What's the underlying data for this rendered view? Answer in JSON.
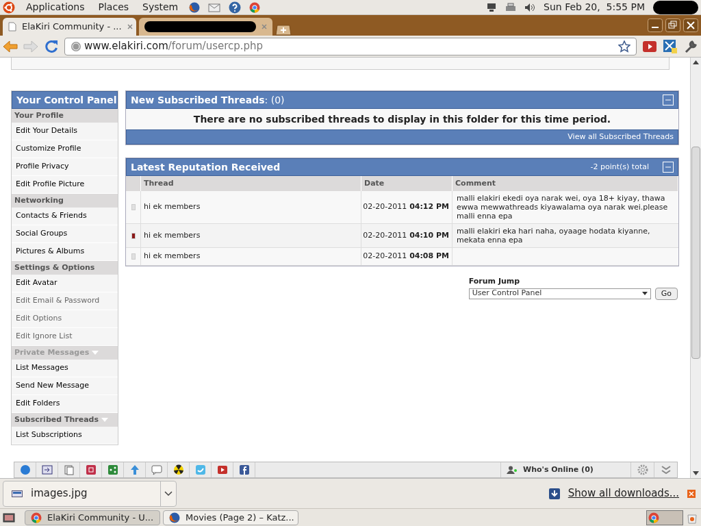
{
  "top_panel": {
    "menus": [
      "Applications",
      "Places",
      "System"
    ],
    "clock": "Sun Feb 20,  5:55 PM"
  },
  "tabs": [
    {
      "kind": "page",
      "label": "ElaKiri Community - ...",
      "selected": true
    },
    {
      "kind": "redacted",
      "selected": false
    }
  ],
  "address_bar": {
    "host": "www.elakiri.com",
    "path": "/forum/usercp.php"
  },
  "sidebar": {
    "title": "Your Control Panel",
    "items": [
      {
        "kind": "header",
        "label": "Your Profile",
        "dimmed": false,
        "collapsible": false
      },
      {
        "kind": "link",
        "label": "Edit Your Details",
        "dimmed": false
      },
      {
        "kind": "link",
        "label": "Customize Profile",
        "dimmed": false
      },
      {
        "kind": "link",
        "label": "Profile Privacy",
        "dimmed": false
      },
      {
        "kind": "link",
        "label": "Edit Profile Picture",
        "dimmed": false
      },
      {
        "kind": "header",
        "label": "Networking",
        "dimmed": false,
        "collapsible": false
      },
      {
        "kind": "link",
        "label": "Contacts & Friends",
        "dimmed": false
      },
      {
        "kind": "link",
        "label": "Social Groups",
        "dimmed": false
      },
      {
        "kind": "link",
        "label": "Pictures & Albums",
        "dimmed": false
      },
      {
        "kind": "header",
        "label": "Settings & Options",
        "dimmed": false,
        "collapsible": false
      },
      {
        "kind": "link",
        "label": "Edit Avatar",
        "dimmed": false
      },
      {
        "kind": "link",
        "label": "Edit Email & Password",
        "dimmed": true
      },
      {
        "kind": "link",
        "label": "Edit Options",
        "dimmed": true
      },
      {
        "kind": "link",
        "label": "Edit Ignore List",
        "dimmed": true
      },
      {
        "kind": "header",
        "label": "Private Messages",
        "dimmed": true,
        "collapsible": true
      },
      {
        "kind": "link",
        "label": "List Messages",
        "dimmed": false
      },
      {
        "kind": "link",
        "label": "Send New Message",
        "dimmed": false
      },
      {
        "kind": "link",
        "label": "Edit Folders",
        "dimmed": false
      },
      {
        "kind": "header",
        "label": "Subscribed Threads",
        "dimmed": false,
        "collapsible": true
      },
      {
        "kind": "link",
        "label": "List Subscriptions",
        "dimmed": false
      }
    ]
  },
  "subscribed": {
    "title": "New Subscribed Threads",
    "count": ": (0)",
    "message": "There are no subscribed threads to display in this folder for this time period.",
    "footer_link": "View all Subscribed Threads"
  },
  "reputation": {
    "title": "Latest Reputation Received",
    "total": "-2 point(s) total",
    "columns": [
      "Thread",
      "Date",
      "Comment"
    ],
    "rows": [
      {
        "color": "#e0e0e0",
        "thread": "hi ek members",
        "date": "02-20-2011",
        "time": "04:12 PM",
        "comment": "malli elakiri ekedi oya narak wei, oya 18+ kiyay, thawa ewwa mewwathreads kiyawalama oya narak wei.please malli enna epa"
      },
      {
        "color": "#8b1a1a",
        "thread": "hi ek members",
        "date": "02-20-2011",
        "time": "04:10 PM",
        "comment": "malli elakiri eka hari naha, oyaage hodata kiyanne, mekata enna epa"
      },
      {
        "color": "#e0e0e0",
        "thread": "hi ek members",
        "date": "02-20-2011",
        "time": "04:08 PM"
      }
    ]
  },
  "forum_jump": {
    "label": "Forum Jump",
    "value": "User Control Panel",
    "button": "Go"
  },
  "social_bar": {
    "whos_online": "Who's Online (0)"
  },
  "download_bar": {
    "file": "images.jpg",
    "show_all": "Show all downloads..."
  },
  "taskbar": [
    {
      "label": "ElaKiri Community - U...",
      "selected": true,
      "kind": "chrome"
    },
    {
      "label": "Movies (Page 2) – Katz...",
      "selected": false,
      "kind": "firefox"
    }
  ]
}
